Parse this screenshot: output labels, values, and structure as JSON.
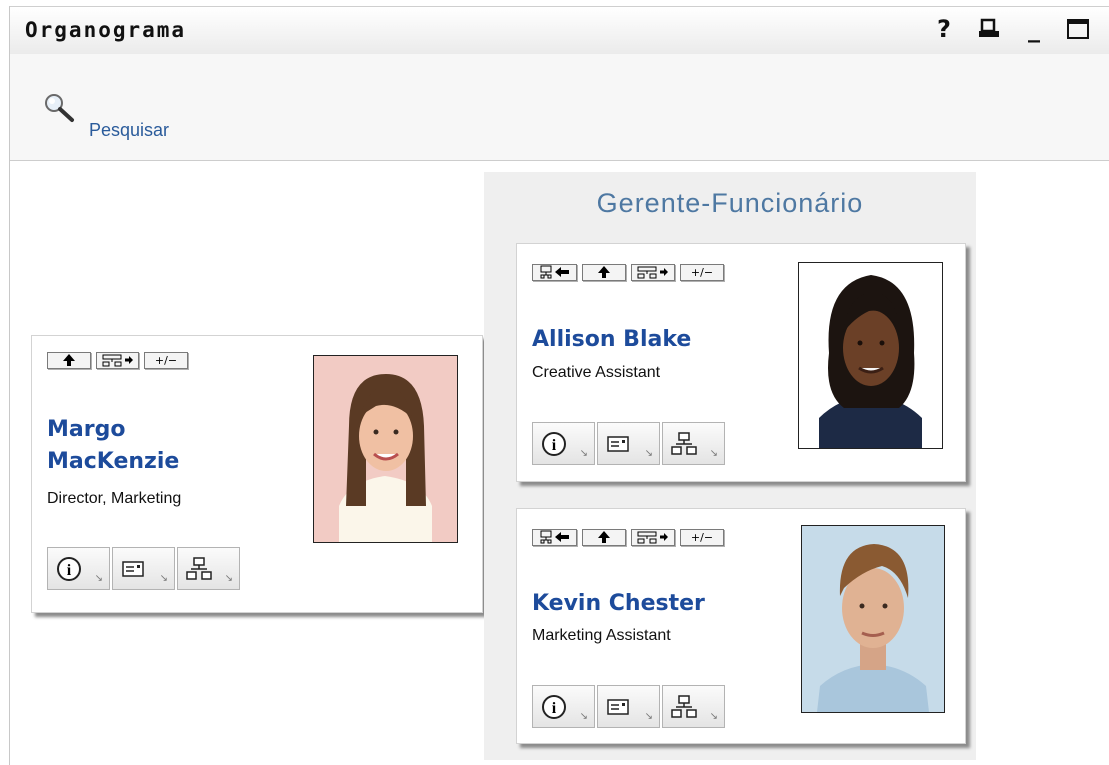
{
  "portlet": {
    "title": "Organograma",
    "help_icon": "?",
    "print_icon": "print-icon",
    "minimize_icon": "_",
    "maximize_icon": "maximize-icon"
  },
  "toolbar": {
    "search_label": "Pesquisar"
  },
  "view": {
    "title": "Gerente-Funcionário"
  },
  "buttons": {
    "up": "↑",
    "expand": "expand-subordinates",
    "toggle": "+/−",
    "back": "back-to-root"
  },
  "cards": {
    "root": {
      "name_line1": "Margo",
      "name_line2": "MacKenzie",
      "job": "Director, Marketing"
    },
    "child1": {
      "name": "Allison Blake",
      "job": "Creative Assistant"
    },
    "child2": {
      "name": "Kevin Chester",
      "job": "Marketing Assistant"
    }
  },
  "actions": [
    "info-icon",
    "email-icon",
    "org-chart-icon"
  ]
}
